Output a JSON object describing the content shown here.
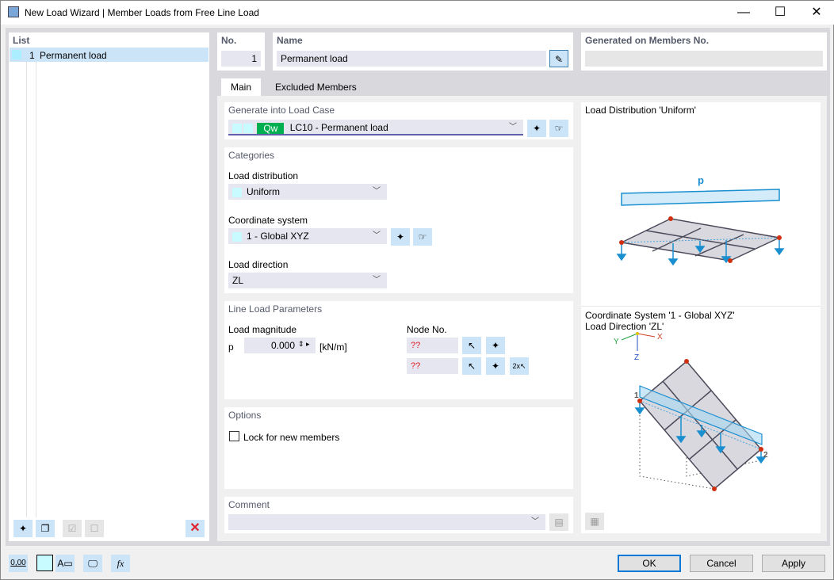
{
  "window": {
    "title": "New Load Wizard | Member Loads from Free Line Load",
    "minimize": "—",
    "maximize": "☐",
    "close": "✕"
  },
  "list": {
    "header": "List",
    "items": [
      {
        "no": "1",
        "name": "Permanent load"
      }
    ]
  },
  "no": {
    "label": "No.",
    "value": "1"
  },
  "name": {
    "label": "Name",
    "value": "Permanent load"
  },
  "generated": {
    "label": "Generated on Members No.",
    "value": ""
  },
  "tabs": [
    {
      "label": "Main"
    },
    {
      "label": "Excluded Members"
    }
  ],
  "load_case": {
    "header": "Generate into Load Case",
    "badge": "Qw",
    "value": "LC10 - Permanent load",
    "badge_color": "#00b050"
  },
  "categories": {
    "header": "Categories",
    "load_distribution_label": "Load distribution",
    "load_distribution": "Uniform",
    "coord_label": "Coordinate system",
    "coord": "1 - Global XYZ",
    "direction_label": "Load direction",
    "direction": "ZL"
  },
  "line_load": {
    "header": "Line Load Parameters",
    "magnitude_label": "Load magnitude",
    "symbol": "p",
    "value": "0.000",
    "unit": "[kN/m]",
    "node_label": "Node No.",
    "node1": "??",
    "node2": "??"
  },
  "options": {
    "header": "Options",
    "lock_label": "Lock for new members",
    "lock_checked": false
  },
  "comment": {
    "header": "Comment",
    "value": ""
  },
  "preview": {
    "title1": "Load Distribution 'Uniform'",
    "load_label": "p",
    "title2": "Coordinate System '1 - Global XYZ'",
    "title3": "Load Direction 'ZL'",
    "axis_x": "X",
    "axis_y": "Y",
    "axis_z": "Z",
    "node1": "1",
    "node2": "2"
  },
  "footer": {
    "ok": "OK",
    "cancel": "Cancel",
    "apply": "Apply",
    "units_icon_text": "0,00"
  }
}
